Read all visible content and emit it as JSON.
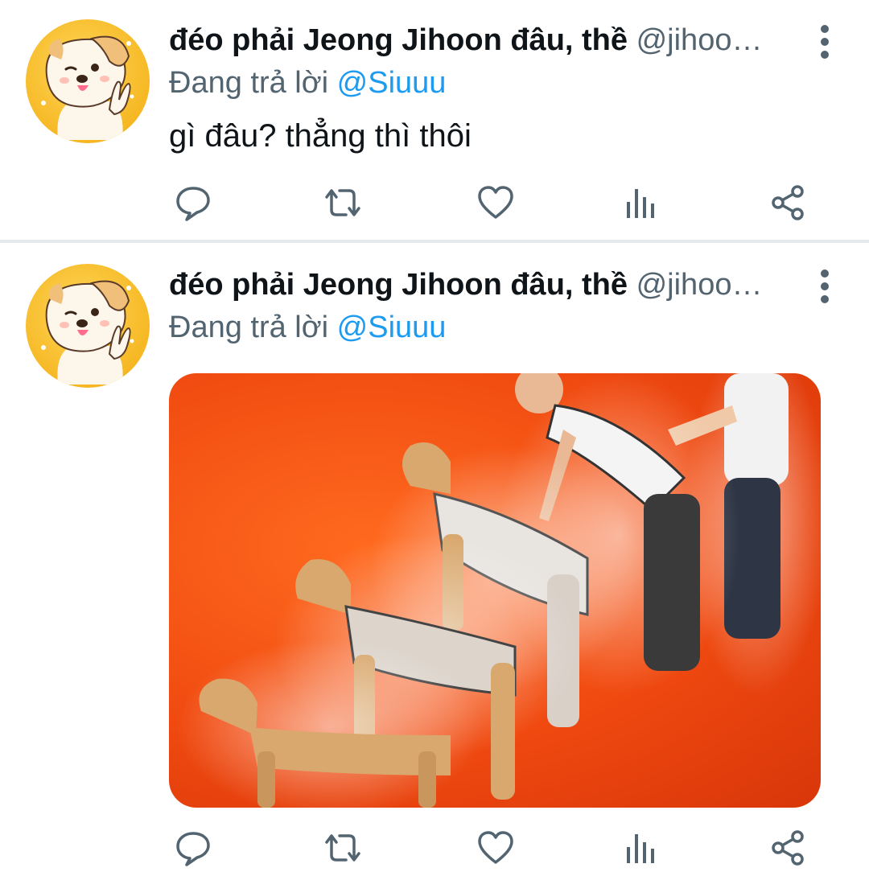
{
  "tweets": [
    {
      "author_name": "đéo phải Jeong Jihoon đâu, thề",
      "author_handle": "@jihoo…",
      "reply_prefix": "Đang trả lời",
      "reply_to": "@Siuuu",
      "text": "gì đâu? thẳng thì thôi"
    },
    {
      "author_name": "đéo phải Jeong Jihoon đâu, thề",
      "author_handle": "@jihoo…",
      "reply_prefix": "Đang trả lời",
      "reply_to": "@Siuuu"
    }
  ],
  "icons": {
    "avatar": "cartoon-puppy-avatar",
    "more": "vertical-ellipsis-icon",
    "reply": "speech-bubble-icon",
    "retweet": "retweet-icon",
    "like": "heart-icon",
    "views": "bar-chart-icon",
    "share": "share-icon"
  },
  "colors": {
    "text": "#0f1419",
    "secondary": "#536471",
    "link": "#1d9bf0",
    "icon": "#536471",
    "divider": "#e6e9ec",
    "avatar_bg": "#f6b824",
    "media_bg": "#f04a10"
  }
}
